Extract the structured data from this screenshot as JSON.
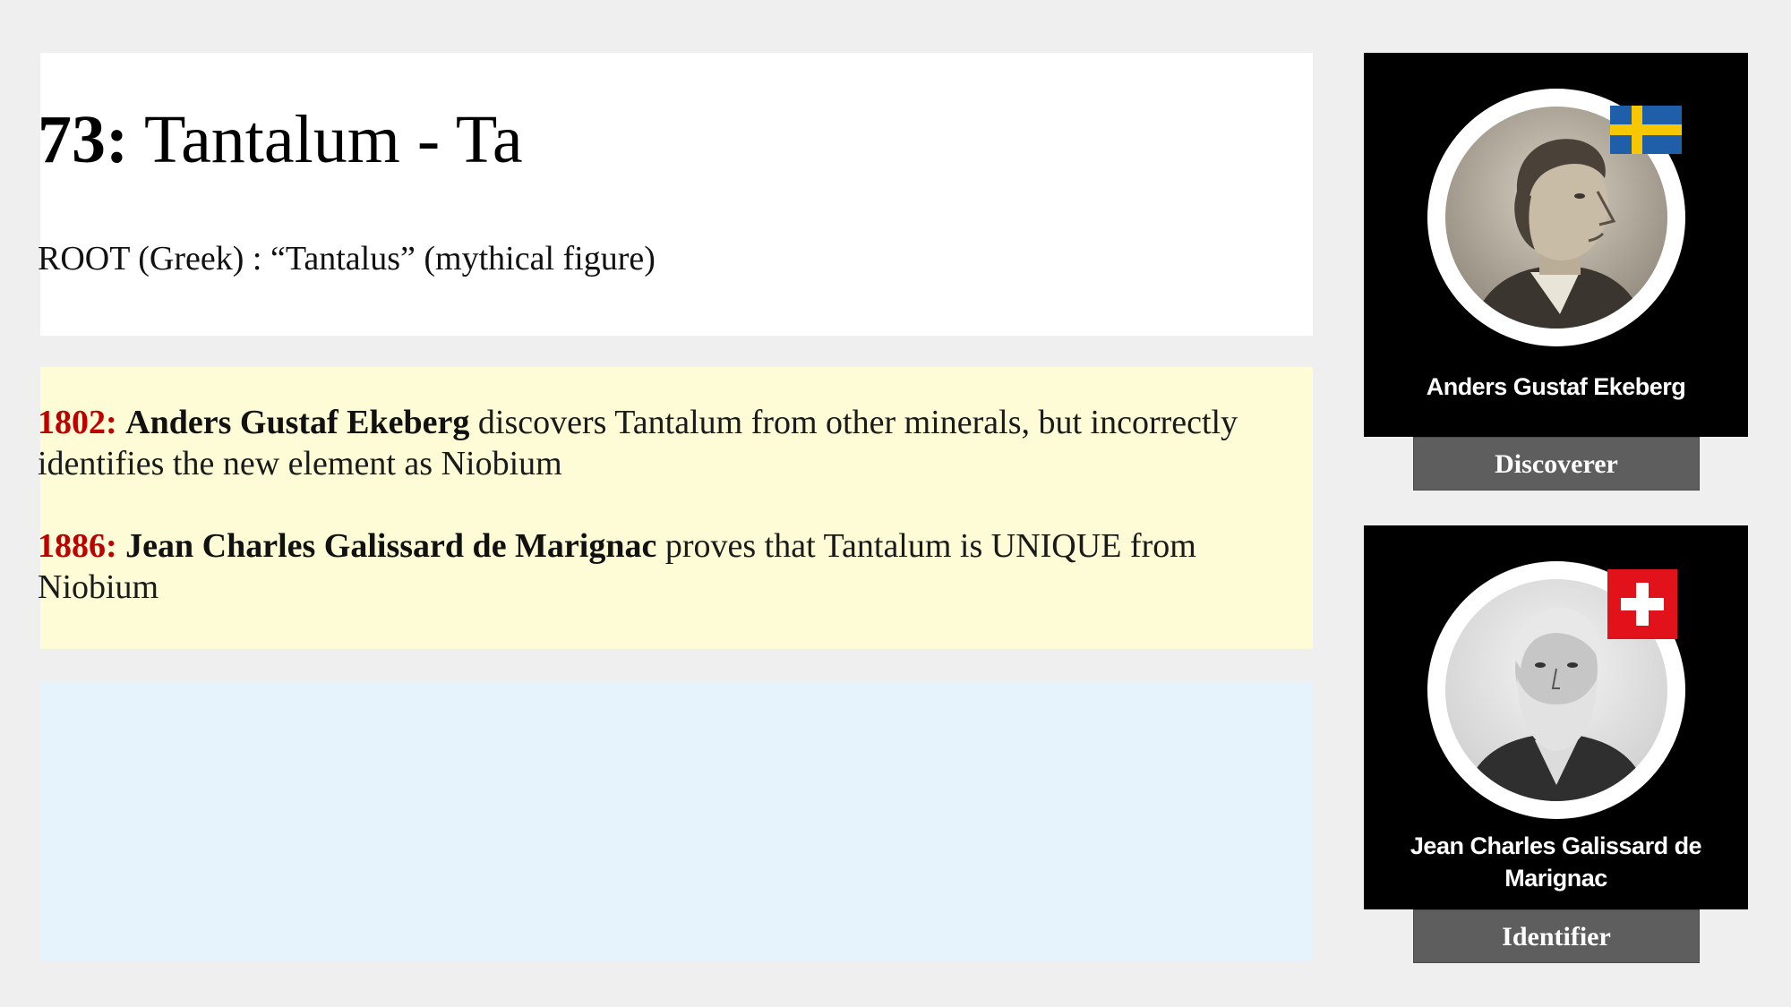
{
  "header": {
    "number": "73:",
    "name": "Tantalum - Ta",
    "root": "ROOT (Greek) : “Tantalus” (mythical figure)"
  },
  "history": [
    {
      "year": "1802:",
      "person": "Anders Gustaf Ekeberg",
      "text": " discovers Tantalum from other minerals, but incorrectly identifies the new element as Niobium"
    },
    {
      "year": "1886:",
      "person": "Jean Charles Galissard de Marignac",
      "text": " proves that Tantalum is UNIQUE from Niobium"
    }
  ],
  "cards": [
    {
      "name": "Anders Gustaf Ekeberg",
      "role": "Discoverer",
      "flag": "sweden-flag-icon"
    },
    {
      "name": "Jean Charles Galissard de Marignac",
      "role": "Identifier",
      "flag": "switzerland-flag-icon"
    }
  ],
  "colors": {
    "year_accent": "#c00000",
    "history_bg": "#fdfcd6",
    "blank_bg": "#e7f3fc",
    "card_bg": "#000000",
    "role_bg": "#5e5e5e"
  }
}
